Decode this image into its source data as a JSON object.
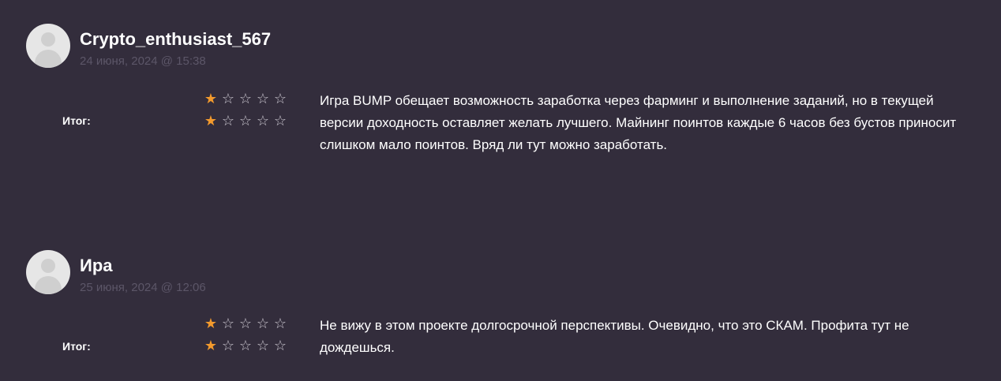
{
  "reviews": [
    {
      "author": "Crypto_enthusiast_567",
      "date": "24 июня, 2024 @ 15:38",
      "total_label": "Итог:",
      "ratings": [
        1,
        1
      ],
      "max_rating": 5,
      "text": "Игра BUMP обещает возможность заработка через фарминг и выполнение заданий, но в текущей версии доходность оставляет желать лучшего. Майнинг поинтов каждые 6 часов без бустов приносит слишком мало поинтов. Вряд ли тут можно заработать."
    },
    {
      "author": "Ира",
      "date": "25 июня, 2024 @ 12:06",
      "total_label": "Итог:",
      "ratings": [
        1,
        1
      ],
      "max_rating": 5,
      "text": "Не вижу в этом проекте долгосрочной перспективы. Очевидно, что это СКАМ. Профита тут не дождешься."
    }
  ],
  "colors": {
    "background": "#332d3c",
    "star_filled": "#f39a2d",
    "star_empty": "#c8c4cd",
    "date_text": "#5c5668"
  },
  "icons": {
    "avatar": "default-user-avatar-icon",
    "star_filled": "filled-star-icon",
    "star_empty": "empty-star-icon"
  }
}
